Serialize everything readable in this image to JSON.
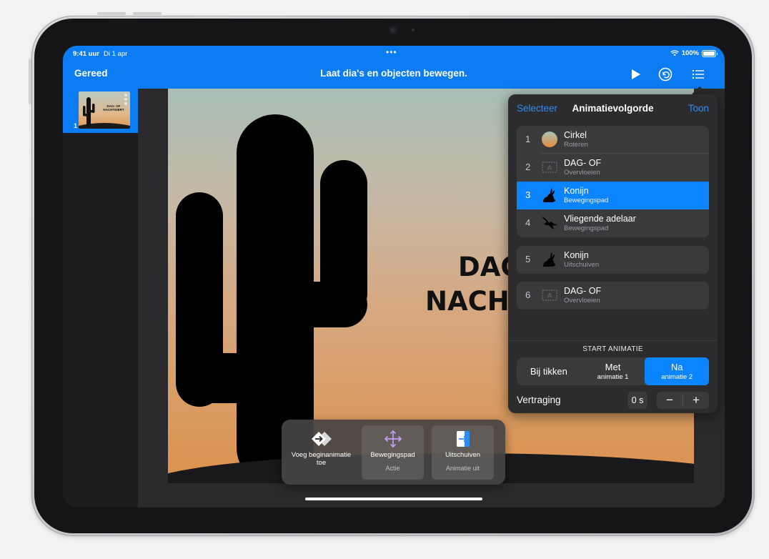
{
  "status": {
    "time": "9:41 uur",
    "date": "Di 1 apr",
    "battery": "100%"
  },
  "toolbar": {
    "done_label": "Gereed",
    "title": "Laat dia's en objecten bewegen.",
    "play_icon": "play-icon",
    "undo_icon": "undo-icon",
    "list_icon": "list-icon"
  },
  "sidebar": {
    "slides": [
      {
        "number": "1",
        "thumbnail_title": "DAG- OF NACHTDIERT"
      }
    ]
  },
  "slide": {
    "title_line1": "DAG",
    "title_line2": "NACH"
  },
  "animation_panel": {
    "select_label": "Selecteer",
    "title": "Animatievolgorde",
    "show_label": "Toon",
    "groups": [
      {
        "items": [
          {
            "number": "1",
            "name": "Cirkel",
            "effect": "Roteren",
            "icon": "circle-icon"
          },
          {
            "number": "2",
            "name": "DAG- OF",
            "effect": "Overvloeien",
            "icon": "textbox-icon"
          },
          {
            "number": "3",
            "name": "Konijn",
            "effect": "Bewegingspad",
            "icon": "rabbit-icon",
            "selected": true
          },
          {
            "number": "4",
            "name": "Vliegende adelaar",
            "effect": "Bewegingspad",
            "icon": "eagle-icon"
          }
        ]
      },
      {
        "items": [
          {
            "number": "5",
            "name": "Konijn",
            "effect": "Uitschuiven",
            "icon": "rabbit-icon"
          }
        ]
      },
      {
        "items": [
          {
            "number": "6",
            "name": "DAG- OF",
            "effect": "Overvloeien",
            "icon": "textbox-icon"
          }
        ]
      }
    ],
    "start_label": "START ANIMATIE",
    "start_options": [
      {
        "label": "Bij tikken",
        "sub": ""
      },
      {
        "label": "Met",
        "sub": "animatie 1"
      },
      {
        "label": "Na",
        "sub": "animatie 2",
        "active": true
      }
    ],
    "delay_label": "Vertraging",
    "delay_value": "0 s",
    "minus": "−",
    "plus": "+"
  },
  "action_tray": {
    "items": [
      {
        "label": "Voeg beginanimatie toe",
        "sub": "",
        "icon": "add-build-in-icon"
      },
      {
        "label": "Bewegingspad",
        "sub": "Actie",
        "icon": "move-arrows-icon"
      },
      {
        "label": "Uitschuiven",
        "sub": "Animatie uit",
        "icon": "slide-out-icon"
      }
    ]
  },
  "colors": {
    "accent": "#0b7cf2",
    "selected_row": "#0a84ff",
    "panel_bg": "#2c2c2e"
  }
}
